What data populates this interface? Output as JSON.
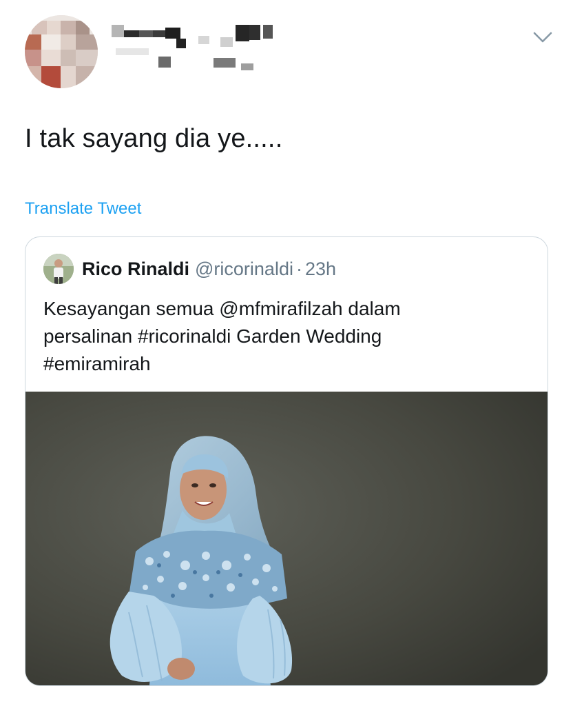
{
  "tweet": {
    "text": "I tak sayang dia ye.....",
    "translate_label": "Translate Tweet",
    "menu_icon": "chevron-down-icon",
    "author_avatar_icon": "pixelated-avatar-icon"
  },
  "quoted_tweet": {
    "author_name": "Rico Rinaldi",
    "author_handle": "@ricorinaldi",
    "separator": "·",
    "time": "23h",
    "text": "Kesayangan semua @mfmirafilzah dalam\npersalinan #ricorinaldi Garden Wedding\n#emiramirah",
    "photo_icon": "woman-in-blue-gown-photo"
  },
  "colors": {
    "link": "#1da1f2",
    "muted": "#657786",
    "text": "#14171a",
    "border": "#ccd6dd"
  }
}
